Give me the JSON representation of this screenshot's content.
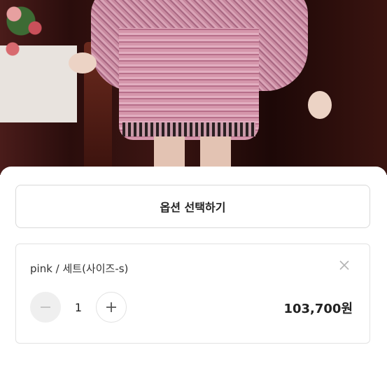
{
  "sheet": {
    "option_select_label": "옵션 선택하기",
    "selected_item": {
      "name": "pink / 세트(사이즈-s)",
      "remove_icon": "close-icon",
      "quantity": "1",
      "minus_icon": "minus-icon",
      "plus_icon": "plus-icon",
      "price": "103,700원"
    }
  }
}
